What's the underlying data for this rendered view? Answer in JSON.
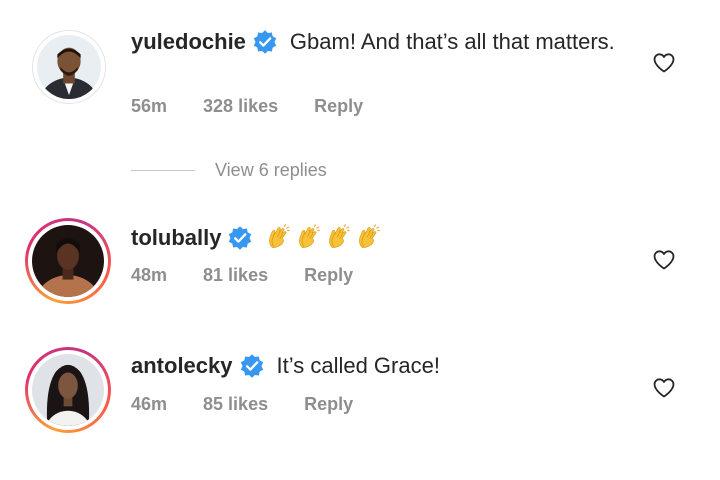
{
  "comments": [
    {
      "username": "yuledochie",
      "verified": true,
      "text": "Gbam! And that’s all that matters.",
      "time": "56m",
      "likes": "328 likes",
      "reply": "Reply",
      "avatar_style": "plain"
    },
    {
      "username": "tolubally",
      "verified": true,
      "text": "",
      "emoji": [
        "clapping-hands",
        "clapping-hands",
        "clapping-hands",
        "clapping-hands"
      ],
      "time": "48m",
      "likes": "81 likes",
      "reply": "Reply",
      "avatar_style": "story-ring"
    },
    {
      "username": "antolecky",
      "verified": true,
      "text": "It’s called Grace!",
      "time": "46m",
      "likes": "85 likes",
      "reply": "Reply",
      "avatar_style": "story-ring"
    }
  ],
  "view_replies": "View 6 replies",
  "colors": {
    "verified_blue": "#3897f0",
    "meta_gray": "#8e8e8e",
    "text": "#262626"
  }
}
